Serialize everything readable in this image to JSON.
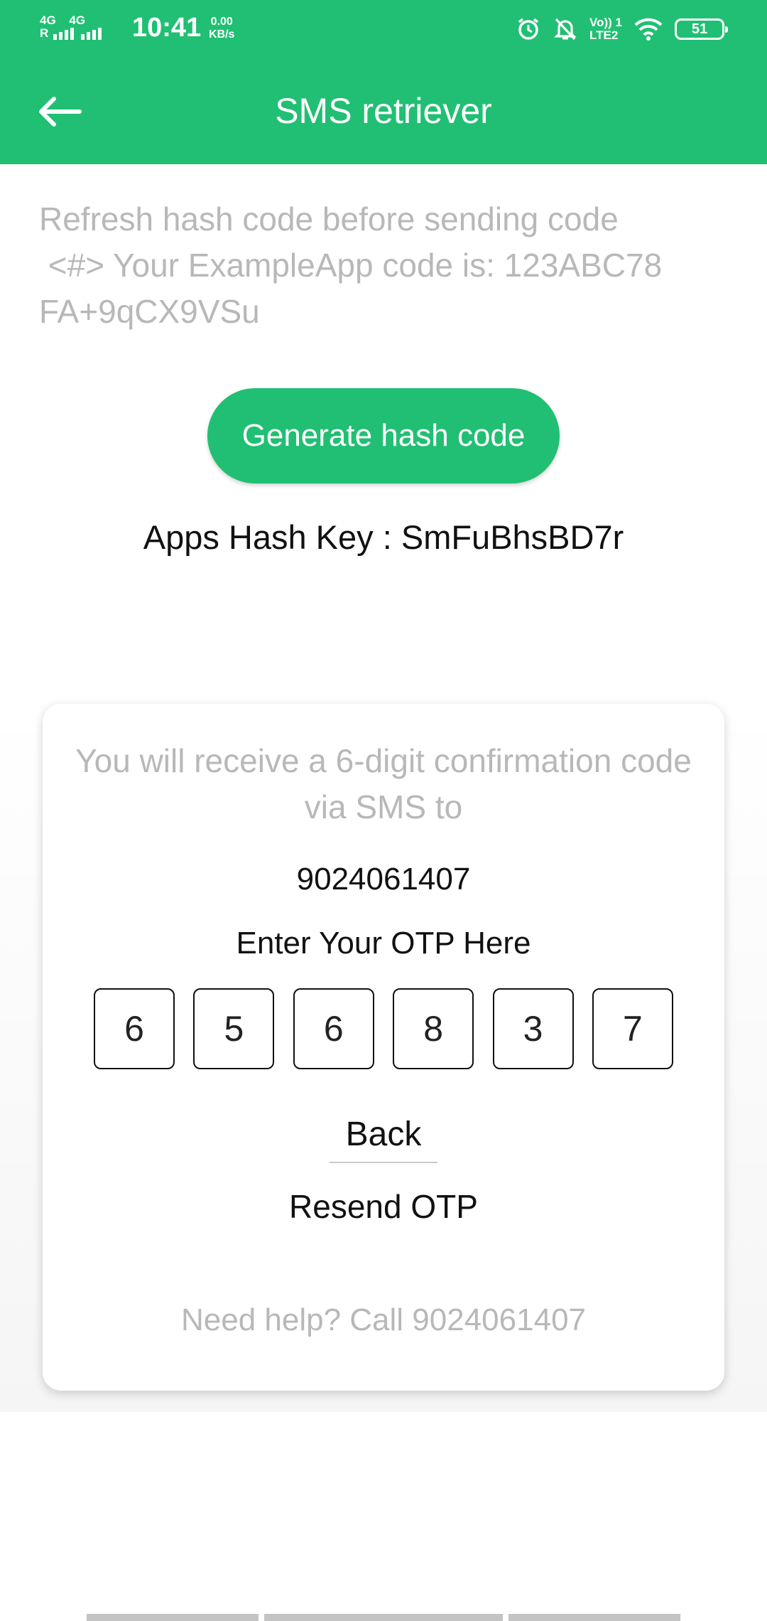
{
  "status_bar": {
    "net1": "4G",
    "net1_sub": "R",
    "net2": "4G",
    "time": "10:41",
    "speed_value": "0.00",
    "speed_unit": "KB/s",
    "volte_top": "Vo)) 1",
    "volte_bottom": "LTE2",
    "battery": "51",
    "icons": [
      "alarm-icon",
      "bell-off-icon",
      "wifi-icon",
      "battery-icon"
    ]
  },
  "app_bar": {
    "title": "SMS retriever",
    "back_icon": "arrow-left-icon"
  },
  "hash_info": {
    "text": "Refresh hash code before sending code\n <#> Your ExampleApp code is: 123ABC78\nFA+9qCX9VSu"
  },
  "generate_button": {
    "label": "Generate hash code"
  },
  "hash_key": {
    "text": "Apps Hash Key : SmFuBhsBD7r"
  },
  "card": {
    "message": "You will receive a 6-digit confirmation code via SMS to",
    "phone": "9024061407",
    "enter_label": "Enter Your OTP Here",
    "otp": [
      "6",
      "5",
      "6",
      "8",
      "3",
      "7"
    ],
    "back_label": "Back",
    "resend_label": "Resend OTP",
    "help_text": "Need help? Call 9024061407"
  },
  "colors": {
    "primary": "#21bf73",
    "muted_text": "#b8b8b8",
    "text": "#111111"
  }
}
